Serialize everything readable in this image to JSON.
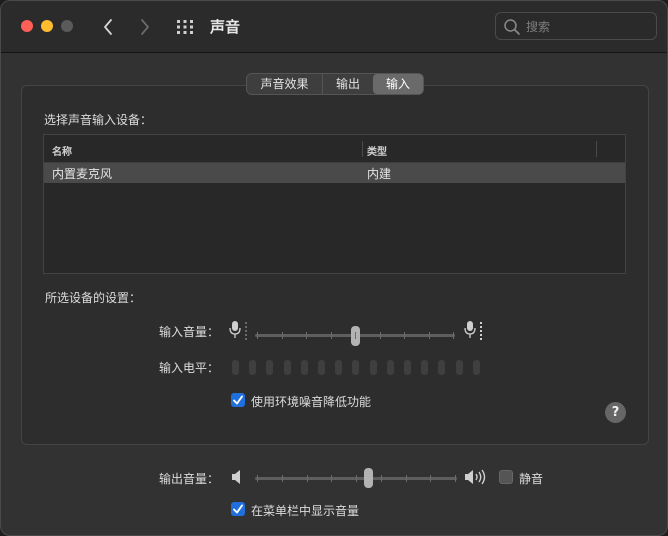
{
  "window": {
    "title": "声音",
    "search": {
      "placeholder": "搜索"
    }
  },
  "tabs": [
    {
      "label": "声音效果",
      "selected": false
    },
    {
      "label": "输出",
      "selected": false
    },
    {
      "label": "输入",
      "selected": true
    }
  ],
  "input": {
    "device_section_label": "选择声音输入设备：",
    "table": {
      "columns": [
        "名称",
        "类型"
      ],
      "rows": [
        {
          "name": "内置麦克风",
          "type": "内建",
          "selected": true
        }
      ]
    },
    "settings_label": "所选设备的设置：",
    "volume_label": "输入音量：",
    "volume_level": 0.5,
    "level_label": "输入电平：",
    "level_bar_count": 15,
    "level_value": 0,
    "noise_reduction": {
      "label": "使用环境噪音降低功能",
      "checked": true
    },
    "help_label": "?"
  },
  "output": {
    "volume_label": "输出音量：",
    "volume_level": 0.56,
    "mute": {
      "label": "静音",
      "checked": false
    },
    "menubar": {
      "label": "在菜单栏中显示音量",
      "checked": true
    }
  },
  "colors": {
    "accent": "#1f6fde",
    "close": "#fe5f57",
    "minimize": "#febc2e"
  },
  "icons": {
    "back": "chevron-left-icon",
    "forward": "chevron-right-icon",
    "grid": "grid-icon",
    "search": "search-icon",
    "mic_low": "microphone-low-icon",
    "mic_high": "microphone-high-icon",
    "speaker_low": "speaker-low-icon",
    "speaker_high": "speaker-high-icon"
  }
}
